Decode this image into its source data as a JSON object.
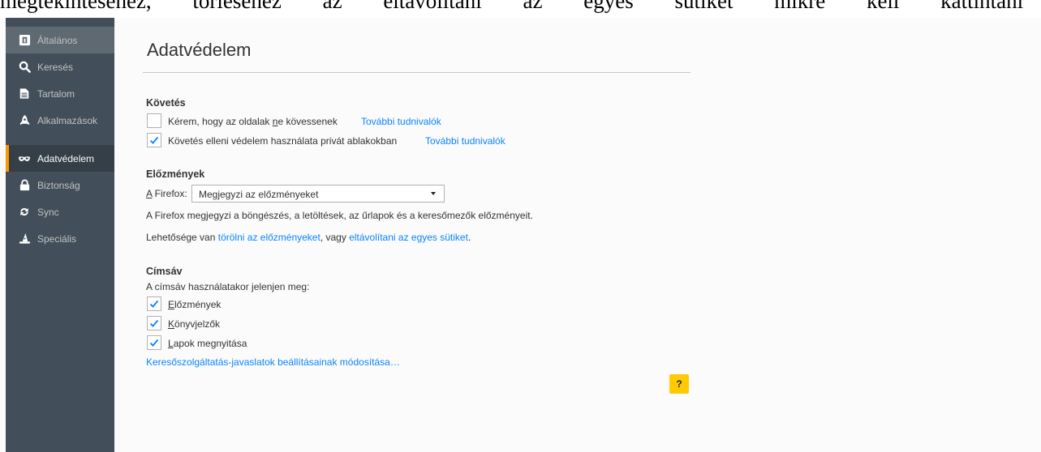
{
  "top_fragment": "megtekintéséhez, törléséhez az eltávolítani az egyes sütiket mikre kell kattintani",
  "sidebar": {
    "items": [
      {
        "label": "Általános",
        "icon": "general-icon"
      },
      {
        "label": "Keresés",
        "icon": "search-icon"
      },
      {
        "label": "Tartalom",
        "icon": "document-icon"
      },
      {
        "label": "Alkalmazások",
        "icon": "rocket-icon"
      },
      {
        "label": "Adatvédelem",
        "icon": "mask-icon",
        "selected": true
      },
      {
        "label": "Biztonság",
        "icon": "lock-icon"
      },
      {
        "label": "Sync",
        "icon": "sync-icon"
      },
      {
        "label": "Speciális",
        "icon": "wizard-hat-icon"
      }
    ]
  },
  "page_title": "Adatvédelem",
  "tracking": {
    "heading": "Követés",
    "dnt_label_pre": "Kérem, hogy az oldalak ",
    "dnt_label_ul": "n",
    "dnt_label_post": "e kövessenek",
    "dnt_checked": false,
    "dnt_learn_more": "További tudnivalók",
    "tp_label": "Követés elleni védelem használata privát ablakokban",
    "tp_checked": true,
    "tp_learn_more": "További tudnivalók"
  },
  "history": {
    "heading": "Előzmények",
    "firefox_label_ul": "A",
    "firefox_label_rest": " Firefox:",
    "select_value": "Megjegyzi az előzményeket",
    "description": "A Firefox megjegyzi a böngészés, a letöltések, az űrlapok és a keresőmezők előzményeit.",
    "option_pre": "Lehetősége van ",
    "clear_link": "törölni az előzményeket",
    "option_mid": ", vagy ",
    "cookies_link": "eltávolítani az egyes sütiket",
    "option_post": "."
  },
  "addressbar": {
    "heading": "Címsáv",
    "intro": "A címsáv használatakor jelenjen meg:",
    "opt_history_ul": "E",
    "opt_history_rest": "lőzmények",
    "opt_history_checked": true,
    "opt_bookmarks_ul": "K",
    "opt_bookmarks_rest": "önyvjelzők",
    "opt_bookmarks_checked": true,
    "opt_tabs_ul": "L",
    "opt_tabs_rest": "apok megnyitása",
    "opt_tabs_checked": true,
    "suggestions_link": "Keresőszolgáltatás-javaslatok beállításainak módosítása…"
  },
  "help_label": "?",
  "colors": {
    "sidebar_bg": "#424f5a",
    "sidebar_selected": "#343f48",
    "accent": "#ff9500",
    "link": "#0a84ff",
    "help": "#ffcb00",
    "check": "#0a84ff"
  }
}
